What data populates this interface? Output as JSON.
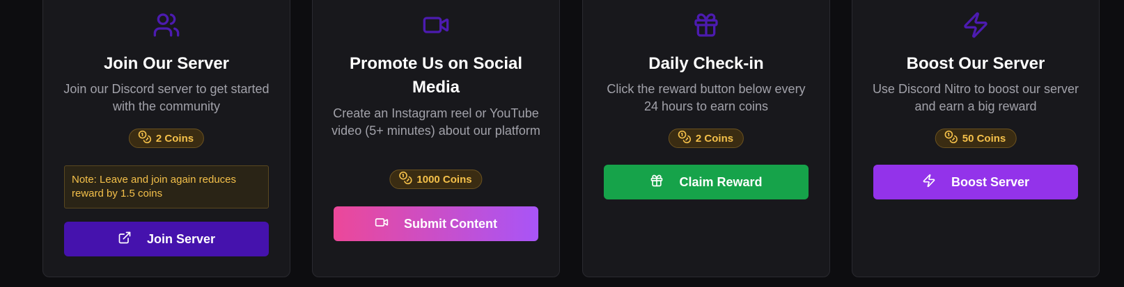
{
  "cards": [
    {
      "icon": "users-icon",
      "title": "Join Our Server",
      "description": "Join our Discord server to get started with the community",
      "coins": "2 Coins",
      "note": "Note: Leave and join again reduces reward by 1.5 coins",
      "button": "Join Server",
      "button_icon": "external-link-icon"
    },
    {
      "icon": "video-icon",
      "title": "Promote Us on Social Media",
      "description": "Create an Instagram reel or YouTube video (5+ minutes) about our platform",
      "coins": "1000 Coins",
      "button": "Submit Content",
      "button_icon": "video-icon"
    },
    {
      "icon": "gift-icon",
      "title": "Daily Check-in",
      "description": "Click the reward button below every 24 hours to earn coins",
      "coins": "2 Coins",
      "button": "Claim Reward",
      "button_icon": "gift-icon"
    },
    {
      "icon": "zap-icon",
      "title": "Boost Our Server",
      "description": "Use Discord Nitro to boost our server and earn a big reward",
      "coins": "50 Coins",
      "button": "Boost Server",
      "button_icon": "zap-icon"
    }
  ],
  "colors": {
    "page_bg": "#0d0d10",
    "card_bg": "#18181c",
    "icon_accent": "#4c1bb0",
    "coin_text": "#f4c04a",
    "join_button": "#4512ad",
    "submit_gradient": [
      "#ec4899",
      "#a855f7"
    ],
    "claim_button": "#16a34a",
    "boost_button": "#9333ea"
  }
}
